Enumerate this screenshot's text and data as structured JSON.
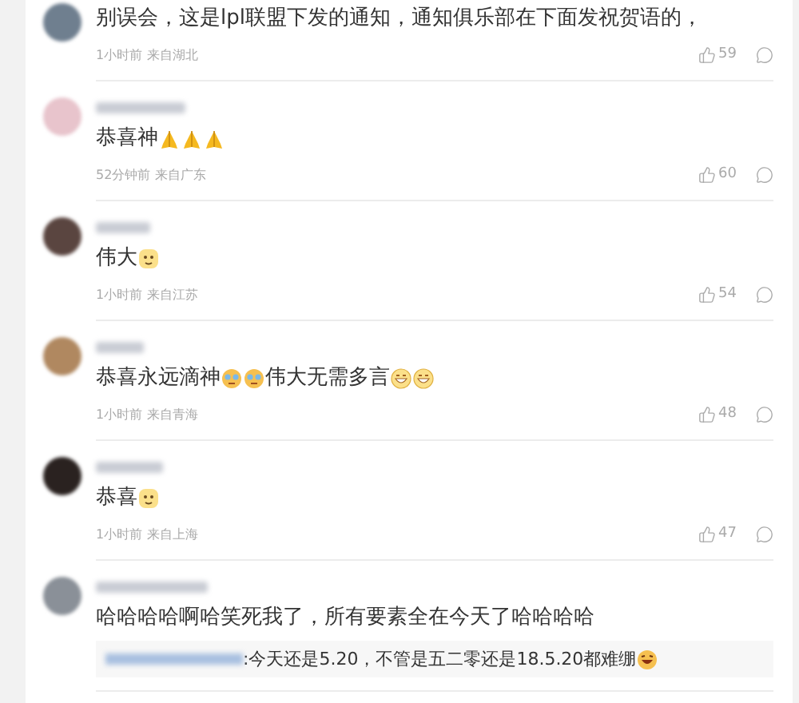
{
  "comments": [
    {
      "avatar": {
        "color": "#6f7f8f"
      },
      "content": [
        {
          "kind": "text",
          "text": "别误会，这是lpl联盟下发的通知，通知俱乐部在下面发祝贺语的，"
        }
      ],
      "time": "1小时前",
      "location": "来自湖北",
      "likes": "59"
    },
    {
      "avatar": {
        "color": "#e8c4cc"
      },
      "content": [
        {
          "kind": "text",
          "text": "恭喜神"
        },
        {
          "kind": "pray"
        },
        {
          "kind": "pray"
        },
        {
          "kind": "pray"
        }
      ],
      "time": "52分钟前",
      "location": "来自广东",
      "likes": "60"
    },
    {
      "avatar": {
        "color": "#5a4540"
      },
      "content": [
        {
          "kind": "text",
          "text": "伟大"
        },
        {
          "kind": "yellow-face"
        }
      ],
      "time": "1小时前",
      "location": "来自江苏",
      "likes": "54"
    },
    {
      "avatar": {
        "color": "#b08860"
      },
      "content": [
        {
          "kind": "text",
          "text": "恭喜永远滴神"
        },
        {
          "kind": "teary-face"
        },
        {
          "kind": "teary-face"
        },
        {
          "kind": "text",
          "text": "伟大无需多言"
        },
        {
          "kind": "grin-face"
        },
        {
          "kind": "grin-face"
        }
      ],
      "time": "1小时前",
      "location": "来自青海",
      "likes": "48"
    },
    {
      "avatar": {
        "color": "#2a2220"
      },
      "content": [
        {
          "kind": "text",
          "text": "恭喜"
        },
        {
          "kind": "yellow-face"
        }
      ],
      "time": "1小时前",
      "location": "来自上海",
      "likes": "47"
    },
    {
      "avatar": {
        "color": "#8a9098"
      },
      "content": [
        {
          "kind": "text",
          "text": "哈哈哈哈啊哈笑死我了，所有要素全在今天了哈哈哈哈"
        }
      ],
      "reply": {
        "content": [
          {
            "kind": "text",
            "text": ":今天还是5.20，不管是五二零还是18.5.20都难绷"
          },
          {
            "kind": "laugh-face"
          }
        ]
      }
    }
  ]
}
